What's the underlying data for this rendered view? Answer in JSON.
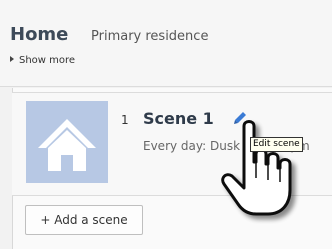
{
  "header": {
    "title": "Home",
    "subtitle": "Primary residence",
    "show_more": "Show more"
  },
  "scenes": [
    {
      "number": "1",
      "name": "Scene 1",
      "schedule": "Every day: Dusk - 11:00 pm",
      "edit_tooltip": "Edit scene"
    }
  ],
  "actions": {
    "add_scene": "+ Add a scene"
  },
  "icons": {
    "thumbnail": "home-icon",
    "edit": "pencil-icon",
    "cursor": "hand-pointer-icon"
  },
  "colors": {
    "thumbnail_bg": "#b7c8e4",
    "edit_icon": "#3a7bd5",
    "title": "#3d4a59"
  }
}
